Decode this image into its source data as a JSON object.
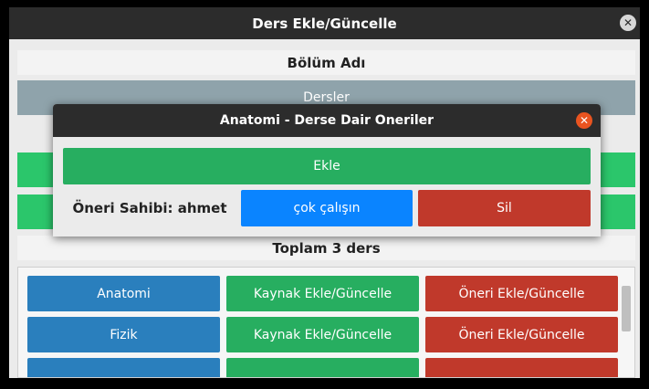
{
  "window": {
    "title": "Ders Ekle/Güncelle",
    "close_icon": "close-icon"
  },
  "section": {
    "bolum_label": "Bölüm Adı",
    "dersler_label": "Dersler",
    "total_label": "Toplam 3 ders"
  },
  "courses": [
    {
      "name": "Anatomi",
      "kaynak_label": "Kaynak Ekle/Güncelle",
      "oneri_label": "Öneri Ekle/Güncelle"
    },
    {
      "name": "Fizik",
      "kaynak_label": "Kaynak Ekle/Güncelle",
      "oneri_label": "Öneri Ekle/Güncelle"
    }
  ],
  "dialog": {
    "title": "Anatomi - Derse Dair Oneriler",
    "add_label": "Ekle",
    "owner_label": "Öneri Sahibi: ahmet",
    "suggestion_label": "çok çalışın",
    "delete_label": "Sil"
  },
  "colors": {
    "green": "#27ae60",
    "blue": "#2a7fbd",
    "red": "#c0392b",
    "suggestion_blue": "#0a84ff",
    "close_orange": "#e95420"
  }
}
